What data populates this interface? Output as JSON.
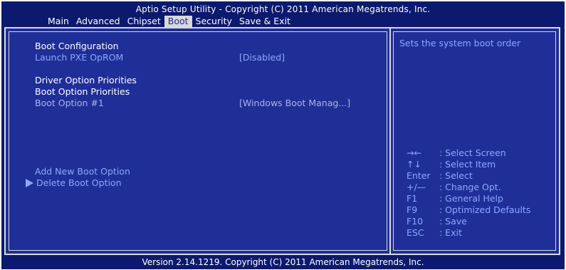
{
  "header": {
    "title": "Aptio Setup Utility - Copyright (C) 2011 American Megatrends, Inc.",
    "tabs": [
      "Main",
      "Advanced",
      "Chipset",
      "Boot",
      "Security",
      "Save & Exit"
    ],
    "active_tab": "Boot"
  },
  "settings": {
    "boot_configuration": "Boot Configuration",
    "launch_pxe_label": "Launch PXE OpROM",
    "launch_pxe_value": "[Disabled]",
    "driver_option_priorities": "Driver Option Priorities",
    "boot_option_priorities": "Boot Option Priorities",
    "boot_option_1_label": "Boot Option #1",
    "boot_option_1_value": "[Windows Boot Manag...]",
    "add_new_boot_option": "Add New Boot Option",
    "delete_boot_option": "Delete Boot Option"
  },
  "help": {
    "text": "Sets the system boot order",
    "keys": [
      {
        "key": "→←",
        "desc": ": Select Screen"
      },
      {
        "key": "↑↓",
        "desc": ": Select Item"
      },
      {
        "key": "Enter",
        "desc": ": Select"
      },
      {
        "key": "+/—",
        "desc": ": Change Opt."
      },
      {
        "key": "F1",
        "desc": ": General Help"
      },
      {
        "key": "F9",
        "desc": ": Optimized Defaults"
      },
      {
        "key": "F10",
        "desc": ": Save"
      },
      {
        "key": "ESC",
        "desc": ": Exit"
      }
    ]
  },
  "footer": {
    "text": "Version 2.14.1219. Copyright (C) 2011 American Megatrends, Inc."
  },
  "colors": {
    "background": "#0b1a6e",
    "panel": "#1f2f97",
    "highlight_text": "#8fa6ff",
    "active_tab_bg": "#d8d8d8"
  }
}
